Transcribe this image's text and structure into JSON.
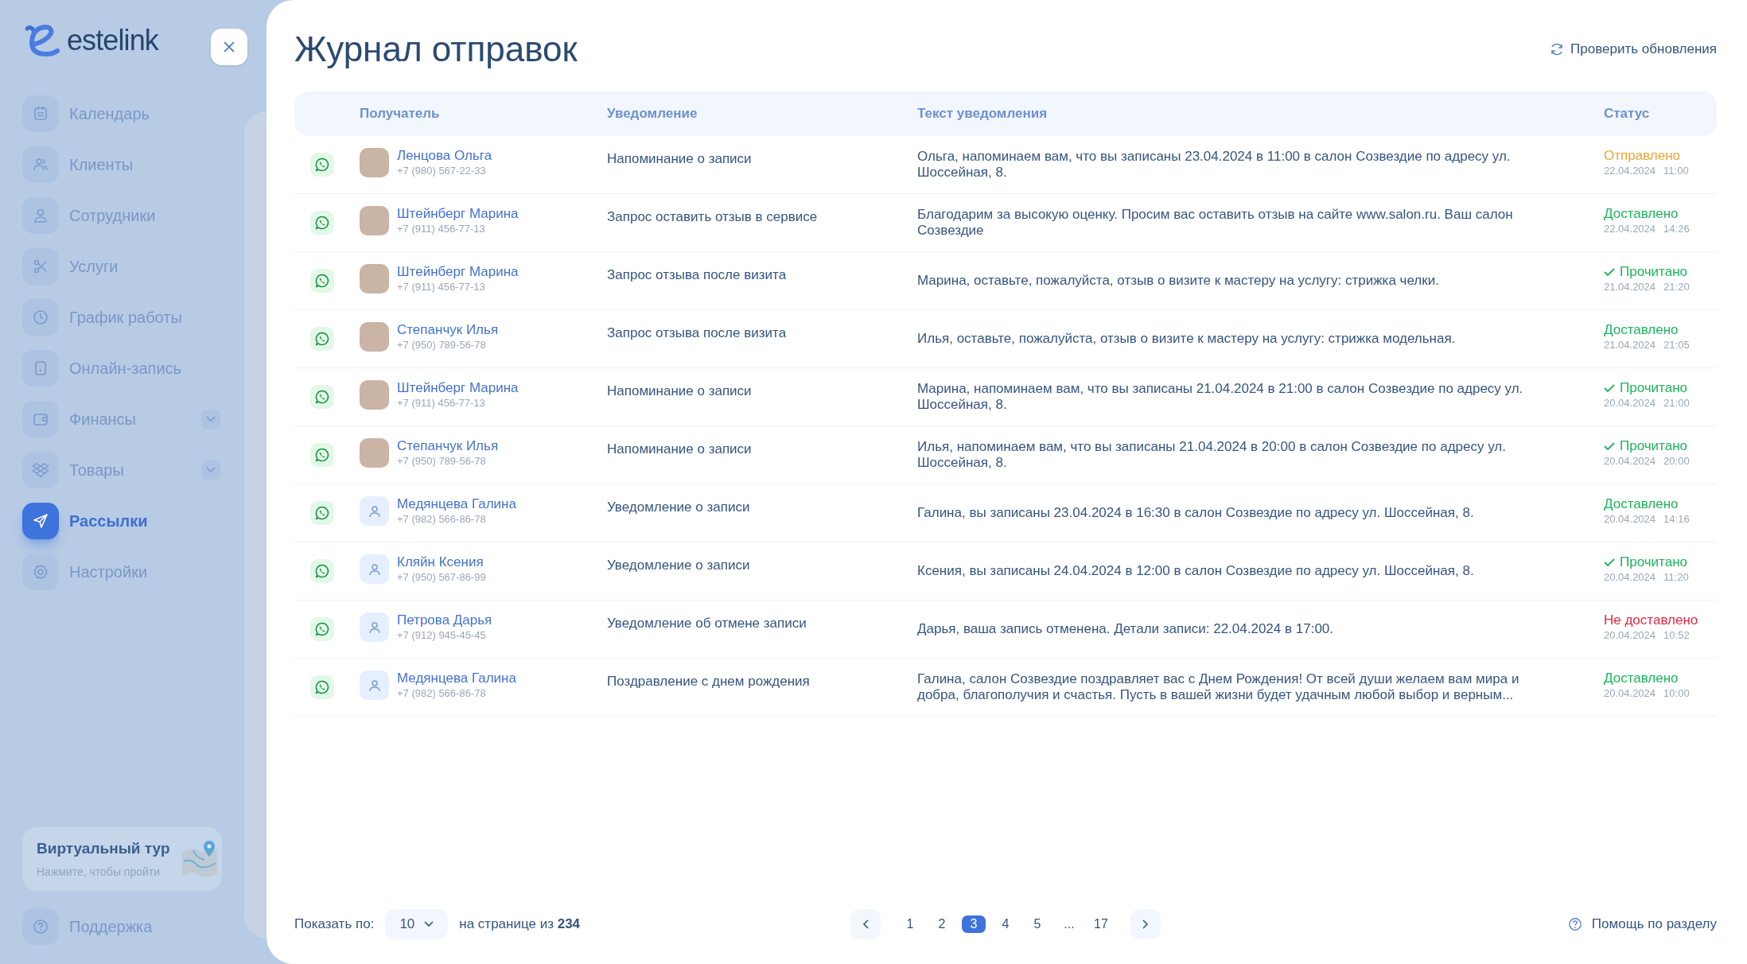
{
  "sidebar": {
    "logo": "estelink",
    "items": [
      {
        "label": "Календарь",
        "kind": "link",
        "selected": false
      },
      {
        "label": "Клиенты",
        "kind": "link",
        "selected": false
      },
      {
        "label": "Сотрудники",
        "kind": "link",
        "selected": false
      },
      {
        "label": "Услуги",
        "kind": "link",
        "selected": false
      },
      {
        "label": "График работы",
        "kind": "link",
        "selected": false
      },
      {
        "label": "Онлайн-запись",
        "kind": "link",
        "selected": false
      },
      {
        "label": "Финансы",
        "kind": "group",
        "selected": false
      },
      {
        "label": "Товары",
        "kind": "group",
        "selected": false
      },
      {
        "label": "Рассылки",
        "kind": "link",
        "selected": true
      },
      {
        "label": "Настройки",
        "kind": "link",
        "selected": false
      }
    ],
    "tour": {
      "title": "Виртуальный тур",
      "subtitle": "Нажмите, чтобы пройти"
    },
    "support": "Поддержка"
  },
  "page": {
    "title": "Журнал отправок",
    "refresh": "Проверить обновления"
  },
  "table": {
    "columns": [
      "Получатель",
      "Уведомление",
      "Текст уведомления",
      "Статус"
    ],
    "rows": [
      {
        "kind": "photo",
        "name": "Ленцова Ольга",
        "phone": "+7 (980) 567-22-33",
        "notification": "Напоминание о записи",
        "text": "Ольга, напоминаем вам, что вы записаны 23.04.2024 в 11:00 в салон Созвездие по адресу ул. Шоссейная, 8.",
        "status": {
          "kind": "sent",
          "label": "Отправлено",
          "date": "22.04.2024",
          "time": "11:00"
        }
      },
      {
        "kind": "photo",
        "name": "Штейнберг Марина",
        "phone": "+7 (911) 456-77-13",
        "notification": "Запрос оставить отзыв в сервисе",
        "text": "Благодарим за высокую оценку. Просим вас оставить отзыв на сайте www.salon.ru. Ваш салон Созвездие",
        "status": {
          "kind": "delivered",
          "label": "Доставлено",
          "date": "22.04.2024",
          "time": "14:26"
        }
      },
      {
        "kind": "photo",
        "name": "Штейнберг Марина",
        "phone": "+7 (911) 456-77-13",
        "notification": "Запрос отзыва после визита",
        "text": "Марина, оставьте, пожалуйста, отзыв о визите к мастеру на услугу: стрижка челки.",
        "status": {
          "kind": "read",
          "label": "Прочитано",
          "date": "21.04.2024",
          "time": "21:20"
        }
      },
      {
        "kind": "photo",
        "name": "Степанчук Илья",
        "phone": "+7 (950) 789-56-78",
        "notification": "Запрос отзыва после визита",
        "text": "Илья, оставьте, пожалуйста, отзыв о визите к мастеру на услугу: стрижка модельная.",
        "status": {
          "kind": "delivered",
          "label": "Доставлено",
          "date": "21.04.2024",
          "time": "21:05"
        }
      },
      {
        "kind": "photo",
        "name": "Штейнберг Марина",
        "phone": "+7 (911) 456-77-13",
        "notification": "Напоминание о записи",
        "text": "Марина, напоминаем вам, что вы записаны 21.04.2024 в 21:00 в салон Созвездие по адресу ул. Шоссейная, 8.",
        "status": {
          "kind": "read",
          "label": "Прочитано",
          "date": "20.04.2024",
          "time": "21:00"
        }
      },
      {
        "kind": "photo",
        "name": "Степанчук Илья",
        "phone": "+7 (950) 789-56-78",
        "notification": "Напоминание о записи",
        "text": "Илья, напоминаем вам, что вы записаны 21.04.2024 в 20:00 в салон Созвездие по адресу ул. Шоссейная, 8.",
        "status": {
          "kind": "read",
          "label": "Прочитано",
          "date": "20.04.2024",
          "time": "20:00"
        }
      },
      {
        "kind": "generic",
        "name": "Медянцева Галина",
        "phone": "+7 (982) 566-86-78",
        "notification": "Уведомление о записи",
        "text": "Галина, вы записаны 23.04.2024 в 16:30 в салон Созвездие по адресу ул. Шоссейная, 8.",
        "status": {
          "kind": "delivered",
          "label": "Доставлено",
          "date": "20.04.2024",
          "time": "14:16"
        }
      },
      {
        "kind": "generic",
        "name": "Кляйн Ксения",
        "phone": "+7 (950) 567-86-99",
        "notification": "Уведомление о записи",
        "text": "Ксения, вы записаны 24.04.2024 в 12:00 в салон Созвездие по адресу ул. Шоссейная, 8.",
        "status": {
          "kind": "read",
          "label": "Прочитано",
          "date": "20.04.2024",
          "time": "11:20"
        }
      },
      {
        "kind": "generic",
        "name": "Петрова Дарья",
        "phone": "+7 (912) 945-45-45",
        "notification": "Уведомление об отмене записи",
        "text": "Дарья, ваша запись отменена. Детали записи: 22.04.2024 в 17:00.",
        "status": {
          "kind": "failed",
          "label": "Не доставлено",
          "date": "20.04.2024",
          "time": "10:52"
        }
      },
      {
        "kind": "generic",
        "name": "Медянцева Галина",
        "phone": "+7 (982) 566-86-78",
        "notification": "Поздравление с днем рождения",
        "text": "Галина, салон Созвездие поздравляет вас с Днем Рождения! От всей души желаем вам мира и добра, благополучия и счастья. Пусть в вашей жизни будет удачным любой выбор и верным...",
        "status": {
          "kind": "delivered",
          "label": "Доставлено",
          "date": "20.04.2024",
          "time": "10:00"
        }
      }
    ]
  },
  "footer": {
    "show_label": "Показать по:",
    "page_size": "10",
    "total": "на странице из **234**",
    "pages": [
      {
        "label": "1",
        "selected": false
      },
      {
        "label": "2",
        "selected": false
      },
      {
        "label": "3",
        "selected": true
      },
      {
        "label": "4",
        "selected": false
      },
      {
        "label": "5",
        "selected": false
      },
      {
        "label": "...",
        "selected": false
      },
      {
        "label": "17",
        "selected": false
      }
    ],
    "help": "Помощь по разделу"
  }
}
